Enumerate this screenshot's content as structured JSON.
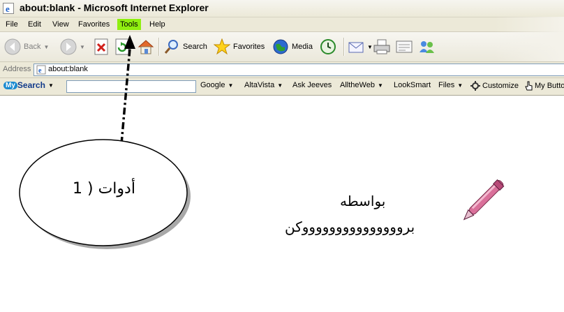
{
  "window": {
    "title": "about:blank - Microsoft Internet Explorer"
  },
  "menu": {
    "items": [
      {
        "label": "File"
      },
      {
        "label": "Edit"
      },
      {
        "label": "View"
      },
      {
        "label": "Favorites"
      },
      {
        "label": "Tools",
        "highlighted": true
      },
      {
        "label": "Help"
      }
    ]
  },
  "toolbar": {
    "back_label": "Back",
    "search_label": "Search",
    "favorites_label": "Favorites",
    "media_label": "Media"
  },
  "address": {
    "label": "Address",
    "value": "about:blank"
  },
  "searchbar": {
    "brand": "Search",
    "brand_prefix": "My",
    "query": "",
    "engines": [
      "Google",
      "AltaVista",
      "Ask Jeeves",
      "AlltheWeb",
      "LookSmart",
      "Files"
    ],
    "customize_label": "Customize",
    "my_buttons_label": "My Butto"
  },
  "annotation": {
    "ellipse_text": "أدوات ( 1",
    "credit_line1": "بواسطه",
    "credit_line2": "بروووووووووووووووكن"
  },
  "colors": {
    "highlight": "#8fef10",
    "pen": "#d9709a"
  }
}
